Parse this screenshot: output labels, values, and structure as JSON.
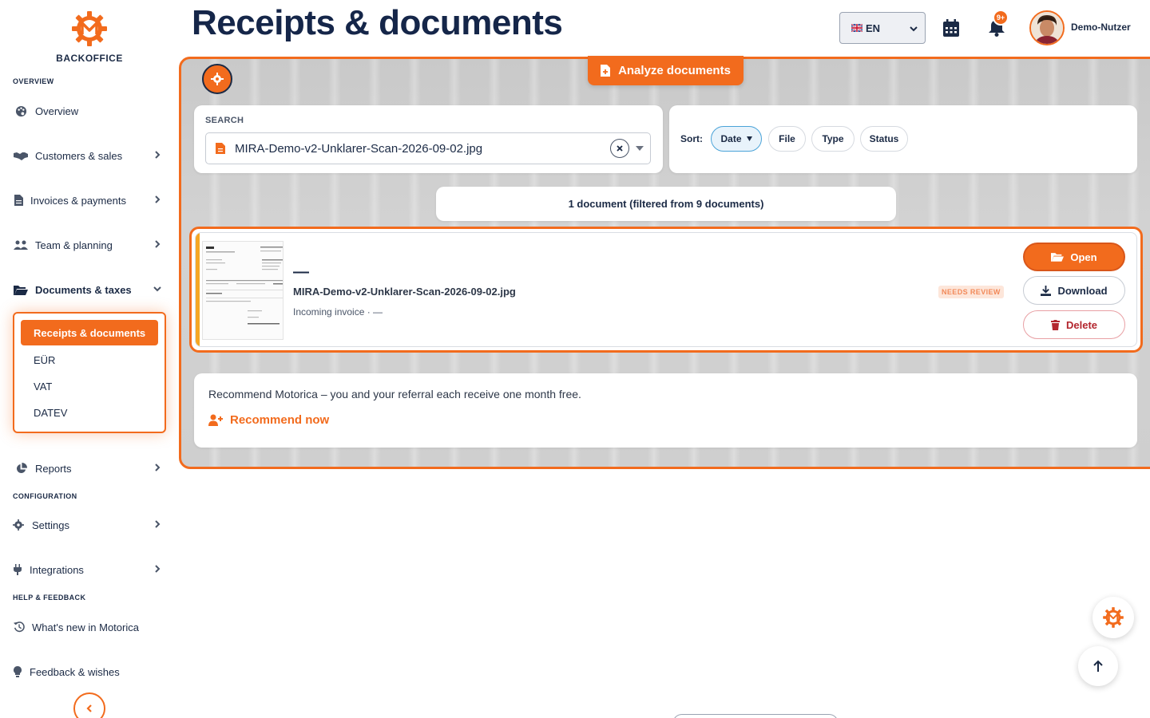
{
  "sidebar": {
    "brand": "BACKOFFICE",
    "sections": {
      "overview": "OVERVIEW",
      "configuration": "CONFIGURATION",
      "help": "HELP & FEEDBACK"
    },
    "items": {
      "overview": "Overview",
      "customers": "Customers & sales",
      "invoices": "Invoices & payments",
      "team": "Team & planning",
      "documents": "Documents & taxes",
      "reports": "Reports",
      "settings": "Settings",
      "integrations": "Integrations",
      "whats_new": "What's new in Motorica",
      "feedback": "Feedback & wishes"
    },
    "submenu": {
      "receipts": "Receipts & documents",
      "eur": "EÜR",
      "vat": "VAT",
      "datev": "DATEV"
    }
  },
  "header": {
    "title": "Receipts & documents",
    "language": "EN",
    "notification_badge": "9+",
    "username": "Demo-Nutzer"
  },
  "toolbar": {
    "analyze_label": "Analyze documents"
  },
  "search": {
    "label": "SEARCH",
    "value": "MIRA-Demo-v2-Unklarer-Scan-2026-09-02.jpg"
  },
  "sort": {
    "label": "Sort:",
    "options": [
      "Date",
      "File",
      "Type",
      "Status"
    ],
    "active": "Date"
  },
  "result_count": "1 document (filtered from 9 documents)",
  "document": {
    "title": "—",
    "filename": "MIRA-Demo-v2-Unklarer-Scan-2026-09-02.jpg",
    "meta": "Incoming invoice · —",
    "status_badge": "NEEDS REVIEW",
    "actions": {
      "open": "Open",
      "download": "Download",
      "delete": "Delete"
    }
  },
  "referral": {
    "text": "Recommend Motorica – you and your referral each receive one month free.",
    "link": "Recommend now"
  },
  "colors": {
    "accent": "#f26b1d",
    "navy": "#152649",
    "danger": "#b3262e",
    "review_badge": "#f28a5a"
  }
}
